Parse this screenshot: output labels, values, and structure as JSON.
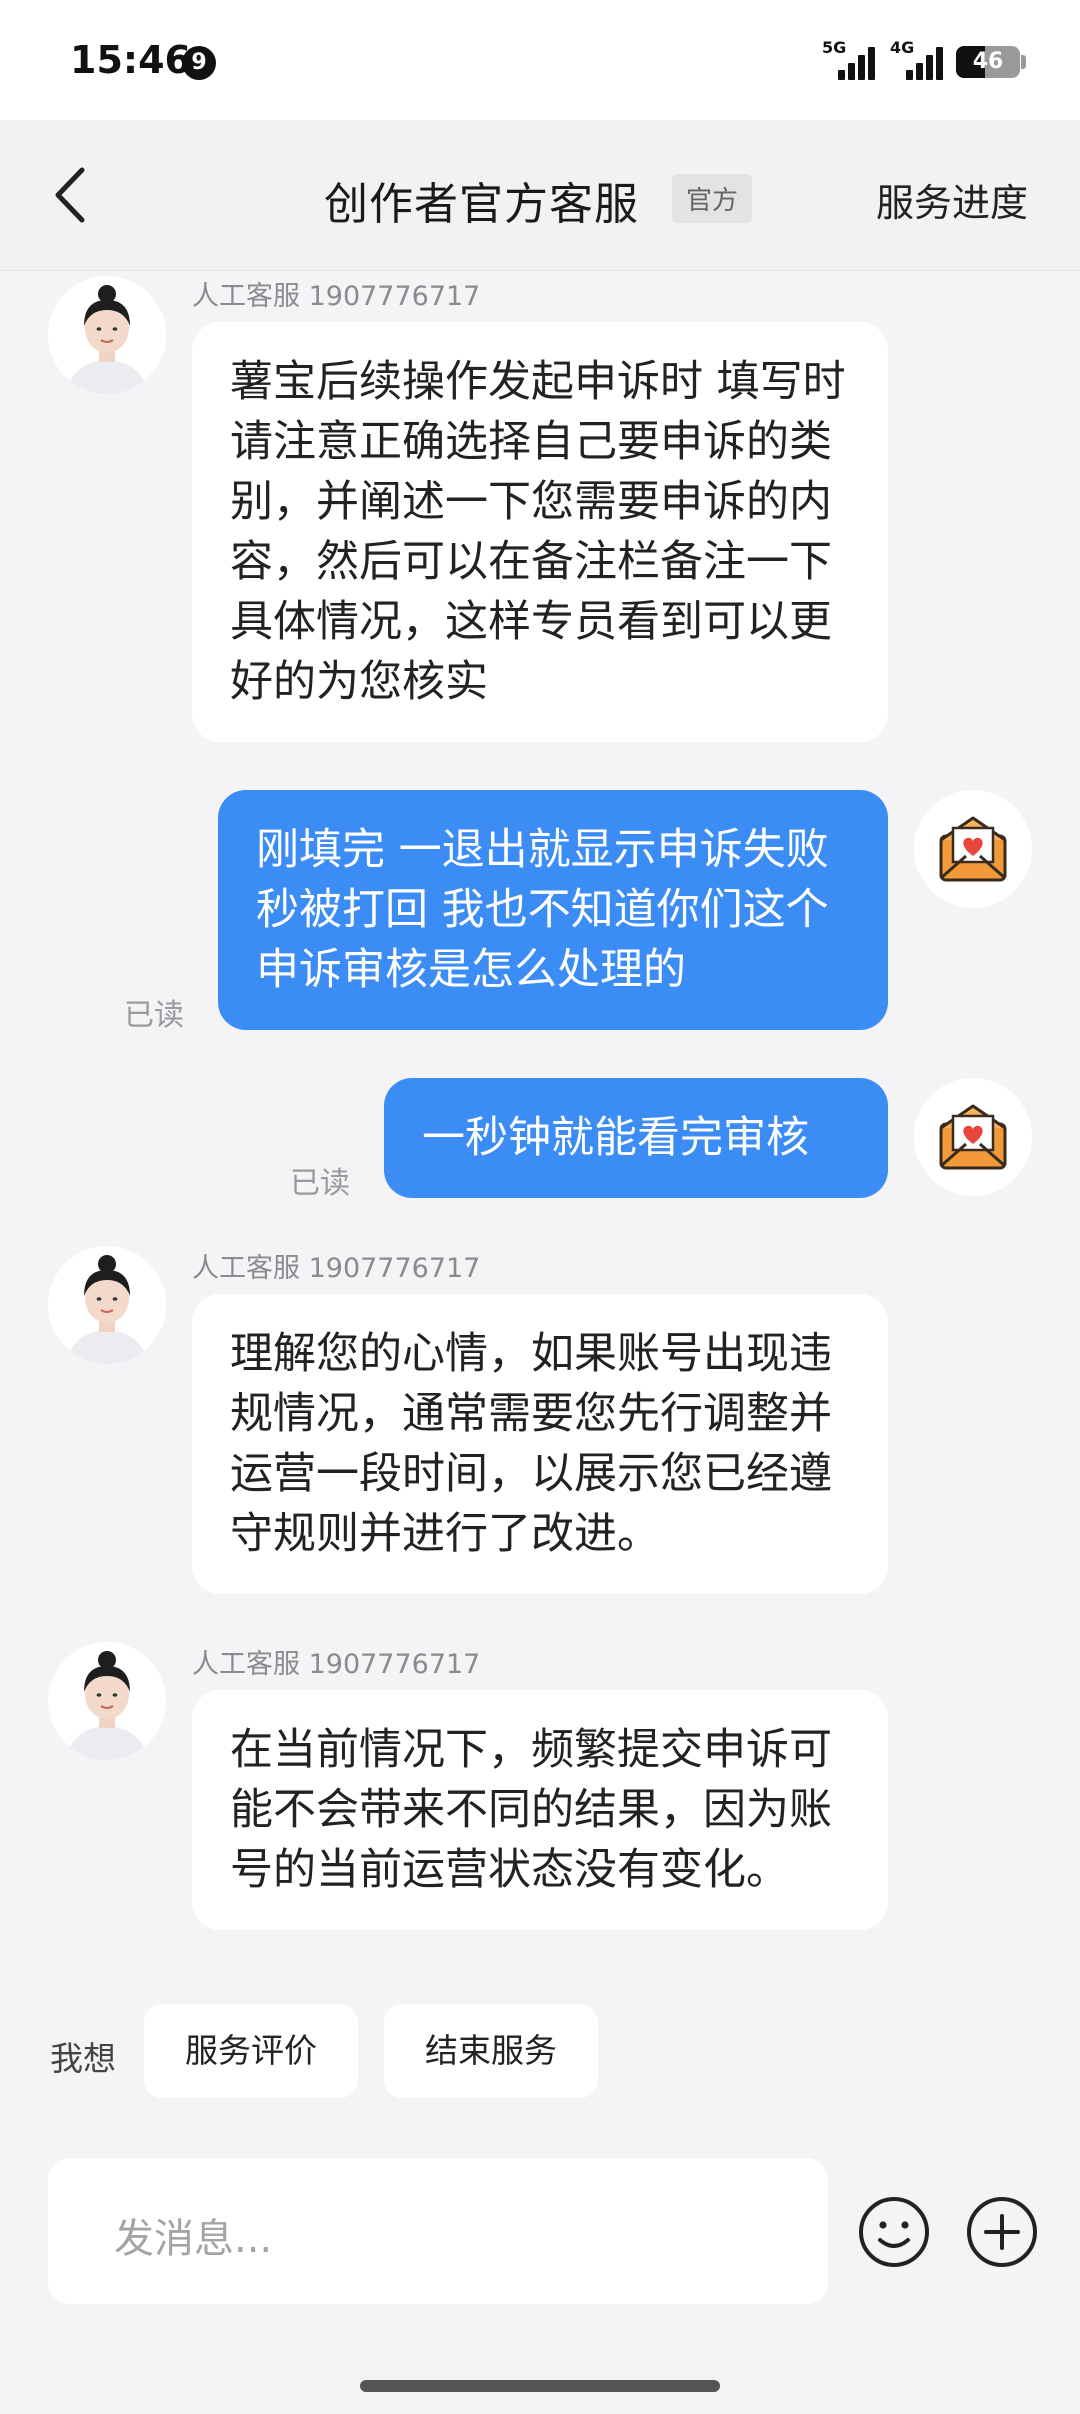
{
  "status_bar": {
    "time": "15:46",
    "notification_count": "9",
    "signal1_label": "5G",
    "signal2_label": "4G",
    "battery": "46"
  },
  "header": {
    "title": "创作者官方客服",
    "badge": "官方",
    "right_action": "服务进度"
  },
  "messages": [
    {
      "from": "agent",
      "sender": "人工客服 1907776717",
      "text": "薯宝后续操作发起申诉时 填写时请注意正确选择自己要申诉的类别，并阐述一下您需要申诉的内容，然后可以在备注栏备注一下具体情况，这样专员看到可以更好的为您核实"
    },
    {
      "from": "me",
      "text": "刚填完 一退出就显示申诉失败 秒被打回 我也不知道你们这个申诉审核是怎么处理的",
      "status": "已读"
    },
    {
      "from": "me",
      "text": "一秒钟就能看完审核",
      "status": "已读"
    },
    {
      "from": "agent",
      "sender": "人工客服 1907776717",
      "text": "理解您的心情，如果账号出现违规情况，通常需要您先行调整并运营一段时间，以展示您已经遵守规则并进行了改进。"
    },
    {
      "from": "agent",
      "sender": "人工客服 1907776717",
      "text": "在当前情况下，频繁提交申诉可能不会带来不同的结果，因为账号的当前运营状态没有变化。"
    }
  ],
  "quick_actions": {
    "label": "我想",
    "items": [
      "服务评价",
      "结束服务"
    ]
  },
  "composer": {
    "placeholder": "发消息..."
  },
  "icons": {
    "back": "chevron-left-icon",
    "emoji": "smiley-icon",
    "add": "plus-circle-icon",
    "my_avatar": "love-letter-icon"
  },
  "colors": {
    "outgoing_bubble": "#3c8cf6",
    "incoming_bubble": "#ffffff",
    "background": "#f4f4f6",
    "envelope": "#f29a3a",
    "heart": "#e8453c"
  }
}
